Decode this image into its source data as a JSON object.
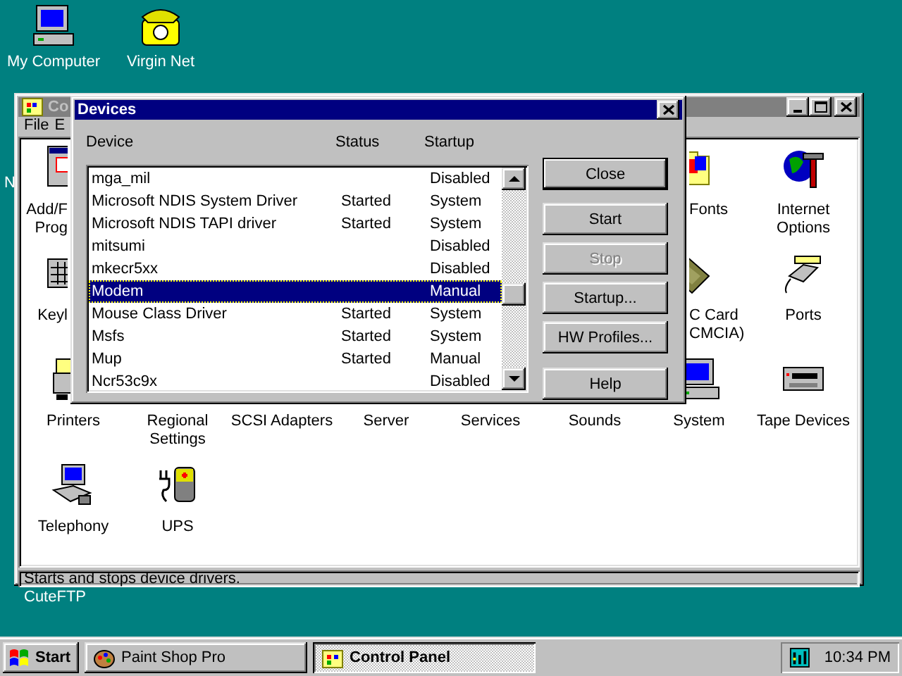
{
  "desktop": {
    "icons": [
      {
        "label": "My Computer"
      },
      {
        "label": "Virgin Net"
      }
    ],
    "cut_labels": [
      {
        "label": "N"
      },
      {
        "label": "CuteFTP"
      }
    ]
  },
  "control_panel": {
    "title": "Co",
    "menu": [
      "File",
      "E"
    ],
    "icon_rows": [
      [
        {
          "label": "Add/F\nProg",
          "kind": "cut_right"
        },
        {
          "label": "Fonts",
          "kind": "cut_left"
        },
        {
          "label": "Internet Options",
          "kind": "full"
        }
      ],
      [
        {
          "label": "Keyl",
          "kind": "cut_right"
        },
        {
          "label": "C Card\nCMCIA)",
          "kind": "cut_left"
        },
        {
          "label": "Ports",
          "kind": "full"
        }
      ],
      [
        {
          "label": "Printers",
          "kind": "cut_icon"
        },
        {
          "label": "Regional Settings",
          "kind": "label_only"
        },
        {
          "label": "SCSI Adapters",
          "kind": "label_only"
        },
        {
          "label": "Server",
          "kind": "label_only"
        },
        {
          "label": "Services",
          "kind": "label_only"
        },
        {
          "label": "Sounds",
          "kind": "label_only"
        },
        {
          "label": "System",
          "kind": "full"
        },
        {
          "label": "Tape Devices",
          "kind": "full"
        }
      ],
      [
        {
          "label": "Telephony",
          "kind": "full"
        },
        {
          "label": "UPS",
          "kind": "full"
        }
      ]
    ],
    "status_bar": "Starts and stops device drivers."
  },
  "devices_dialog": {
    "title": "Devices",
    "columns": [
      "Device",
      "Status",
      "Startup"
    ],
    "rows": [
      {
        "device": "mga_mil",
        "startup": "Disabled",
        "selected": false
      },
      {
        "device": "Microsoft NDIS System Driver",
        "status": "Started",
        "startup": "System",
        "selected": false
      },
      {
        "device": "Microsoft NDIS TAPI driver",
        "status": "Started",
        "startup": "System",
        "selected": false
      },
      {
        "device": "mitsumi",
        "startup": "Disabled",
        "selected": false
      },
      {
        "device": "mkecr5xx",
        "startup": "Disabled",
        "selected": false
      },
      {
        "device": "Modem",
        "startup": "Manual",
        "selected": true
      },
      {
        "device": "Mouse Class Driver",
        "status": "Started",
        "startup": "System",
        "selected": false
      },
      {
        "device": "Msfs",
        "status": "Started",
        "startup": "System",
        "selected": false
      },
      {
        "device": "Mup",
        "status": "Started",
        "startup": "Manual",
        "selected": false
      },
      {
        "device": "Ncr53c9x",
        "startup": "Disabled",
        "selected": false
      }
    ],
    "buttons": [
      {
        "label": "Close",
        "default": true,
        "disabled": false
      },
      {
        "label": "Start",
        "default": false,
        "disabled": false
      },
      {
        "label": "Stop",
        "default": false,
        "disabled": true
      },
      {
        "label": "Startup...",
        "default": false,
        "disabled": false
      },
      {
        "label": "HW Profiles...",
        "default": false,
        "disabled": false
      },
      {
        "label": "Help",
        "default": false,
        "disabled": false
      }
    ]
  },
  "taskbar": {
    "start": "Start",
    "tasks": [
      {
        "label": "Paint Shop Pro",
        "selected": false
      },
      {
        "label": "Control Panel",
        "selected": true
      }
    ],
    "clock": "10:34 PM"
  }
}
